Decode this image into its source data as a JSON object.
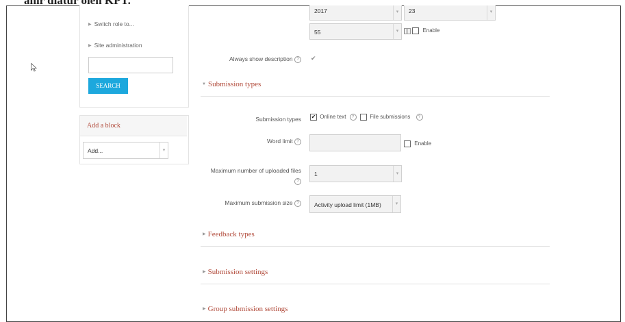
{
  "caption": "ahir diatur oleh KPT.",
  "sidebar": {
    "nav": [
      {
        "label": "Switch role to..."
      },
      {
        "label": "Site administration"
      }
    ],
    "search_button": "SEARCH",
    "add_block": {
      "title": "Add a block",
      "select_value": "Add..."
    }
  },
  "date_row": {
    "year": "2017",
    "day": "23",
    "minute": "55",
    "enable_label": "Enable"
  },
  "always_show_description": {
    "label": "Always show description",
    "checked": true
  },
  "sections": {
    "submission_types": "Submission types",
    "feedback_types": "Feedback types",
    "submission_settings": "Submission settings",
    "group_submission_settings": "Group submission settings"
  },
  "submission_types": {
    "label": "Submission types",
    "online_text": "Online text",
    "file_submissions": "File submissions"
  },
  "word_limit": {
    "label": "Word limit",
    "enable_label": "Enable"
  },
  "max_files": {
    "label_line1": "Maximum number of uploaded files",
    "value": "1"
  },
  "max_size": {
    "label": "Maximum submission size",
    "value": "Activity upload limit (1MB)"
  },
  "icons": [
    "help-icon",
    "calendar-icon",
    "mouse-cursor-icon",
    "triangle-right-icon",
    "triangle-down-icon"
  ]
}
